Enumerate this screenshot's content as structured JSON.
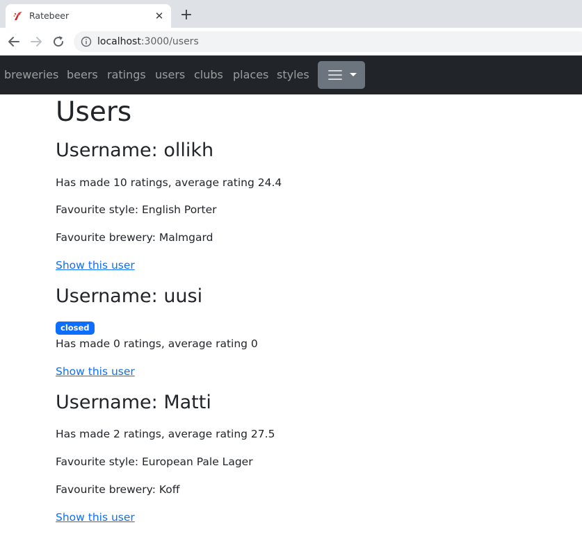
{
  "browser": {
    "tab_title": "Ratebeer",
    "url_host": "localhost",
    "url_path": ":3000/users"
  },
  "nav": {
    "links": [
      "breweries",
      "beers",
      "ratings",
      "users",
      "clubs",
      "places",
      "styles"
    ],
    "toggle_icon": "hamburger-icon"
  },
  "page": {
    "title": "Users"
  },
  "users": [
    {
      "heading": "Username: ollikh",
      "ratings_line": "Has made 10 ratings, average rating 24.4",
      "style_line": "Favourite style: English Porter",
      "brewery_line": "Favourite brewery: Malmgard",
      "link_text": "Show this user"
    },
    {
      "heading": "Username: uusi",
      "badge": "closed",
      "ratings_line": "Has made 0 ratings, average rating 0",
      "link_text": "Show this user"
    },
    {
      "heading": "Username: Matti",
      "ratings_line": "Has made 2 ratings, average rating 27.5",
      "style_line": "Favourite style: European Pale Lager",
      "brewery_line": "Favourite brewery: Koff",
      "link_text": "Show this user"
    }
  ],
  "colors": {
    "navbar_bg": "#212529",
    "link": "#0d6efd",
    "badge_bg": "#0d6efd",
    "toggle_bg": "#6c757d"
  }
}
